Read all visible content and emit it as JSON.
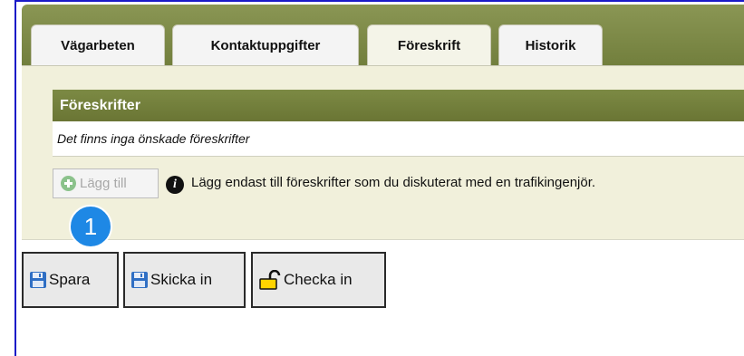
{
  "tabs": [
    {
      "label": "Vägarbeten",
      "active": false
    },
    {
      "label": "Kontaktuppgifter",
      "active": false
    },
    {
      "label": "Föreskrift",
      "active": true
    },
    {
      "label": "Historik",
      "active": false
    }
  ],
  "section": {
    "title": "Föreskrifter",
    "empty_message": "Det finns inga önskade föreskrifter"
  },
  "add_button": {
    "label": "Lägg till",
    "icon": "plus-circle-icon",
    "enabled": false
  },
  "info": {
    "icon": "info-icon",
    "text": "Lägg endast till föreskrifter som du diskuterat med en trafikingenjör."
  },
  "annotation_badge": {
    "number": "1"
  },
  "actions": [
    {
      "label": "Spara",
      "icon": "floppy-disk-icon"
    },
    {
      "label": "Skicka in",
      "icon": "floppy-disk-icon"
    },
    {
      "label": "Checka in",
      "icon": "padlock-icon"
    }
  ],
  "colors": {
    "frame": "#1a1ac8",
    "tab_bar": "#7c8a44",
    "panel": "#f1f0db",
    "badge": "#1e88e5"
  }
}
